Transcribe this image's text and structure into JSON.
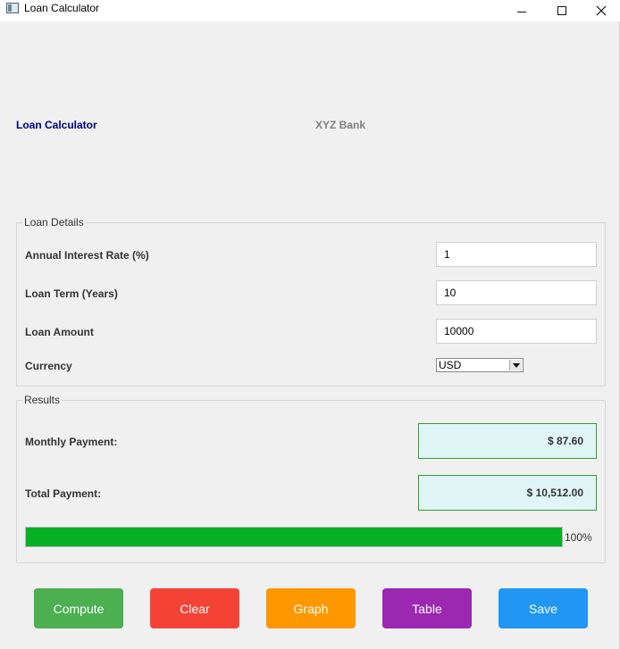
{
  "window": {
    "title": "Loan Calculator",
    "icon": "app-window-icon"
  },
  "header": {
    "title": "Loan Calculator",
    "bank": "XYZ Bank"
  },
  "loan_details": {
    "legend": "Loan Details",
    "interest_label": "Annual Interest Rate (%)",
    "interest_value": "1",
    "term_label": "Loan Term (Years)",
    "term_value": "10",
    "amount_label": "Loan Amount",
    "amount_value": "10000",
    "currency_label": "Currency",
    "currency_value": "USD"
  },
  "results": {
    "legend": "Results",
    "monthly_label": "Monthly Payment:",
    "monthly_value": "$ 87.60",
    "total_label": "Total Payment:",
    "total_value": "$ 10,512.00",
    "progress_percent": 100,
    "progress_text": "100%"
  },
  "buttons": {
    "compute": "Compute",
    "clear": "Clear",
    "graph": "Graph",
    "table": "Table",
    "save": "Save"
  },
  "colors": {
    "header_title": "#000080",
    "header_bank": "#808080",
    "result_bg": "#e0f5f5",
    "result_border": "#2e9e2e",
    "progress_fill": "#06b025",
    "compute": "#4caf50",
    "clear": "#f44336",
    "graph": "#ff9800",
    "table": "#9c27b0",
    "save": "#2196f3"
  }
}
